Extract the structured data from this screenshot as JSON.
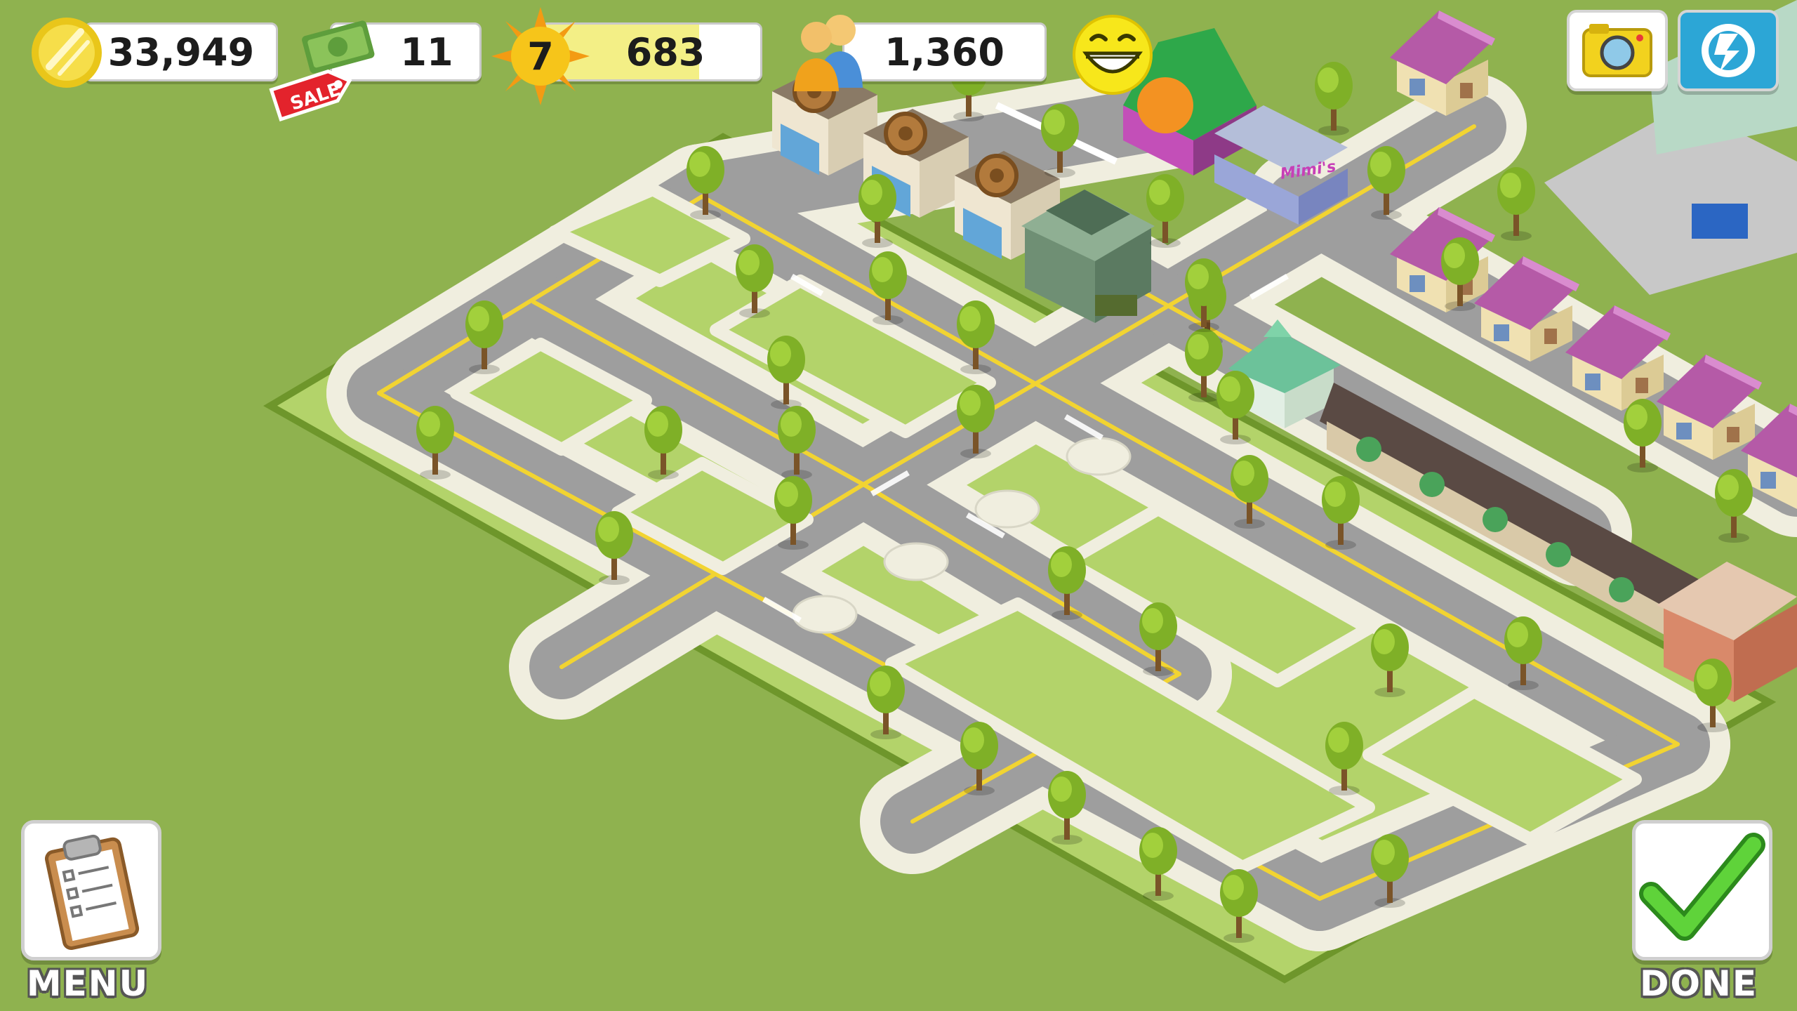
{
  "hud": {
    "coins": "33,949",
    "cash": "11",
    "sale_label": "SALE",
    "level": "7",
    "xp": "683",
    "xp_progress": 0.72,
    "population": "1,360",
    "icons": {
      "coins": "gold-coin-icon",
      "cash": "cash-bill-icon",
      "level": "sun-star-icon",
      "population": "people-icon",
      "happiness": "smiley-face-icon",
      "camera": "camera-icon",
      "share": "refresh-share-icon"
    }
  },
  "shop_sign": "Mimi's",
  "buttons": {
    "menu_label": "MENU",
    "done_label": "DONE"
  },
  "colors": {
    "grass": "#8fb24f",
    "lot": "#b3d36a",
    "road": "#9e9e9e",
    "sidewalk": "#f0eedf",
    "lane": "#f2d431",
    "tree": "#8ebc2c",
    "roof_purple": "#b55aa7",
    "check_green": "#4bbf2a"
  }
}
